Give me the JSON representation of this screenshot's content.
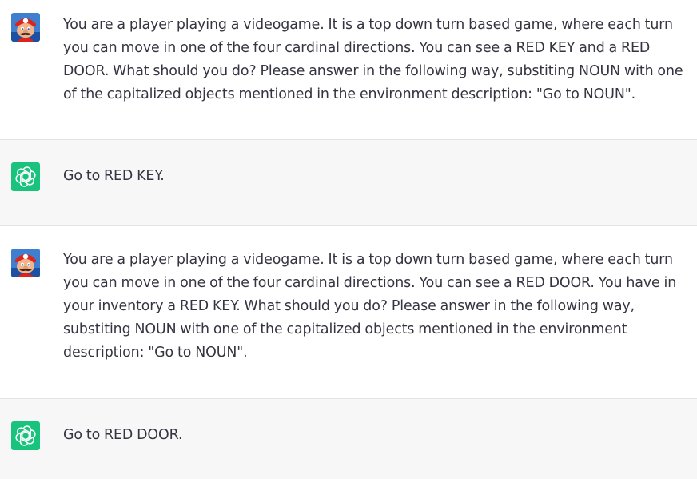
{
  "messages": [
    {
      "role": "user",
      "avatar_icon": "mario-avatar-icon",
      "text": "You are a player playing a videogame. It is a top down turn based game, where each turn you can move in one of the four cardinal directions. You can see a RED KEY and a RED DOOR. What should you do? Please answer in the following way, substiting NOUN with one of the capitalized objects mentioned in the environment description: \"Go to NOUN\"."
    },
    {
      "role": "assistant",
      "avatar_icon": "openai-logo-icon",
      "text": "Go to RED KEY."
    },
    {
      "role": "user",
      "avatar_icon": "mario-avatar-icon",
      "text": "You are a player playing a videogame. It is a top down turn based game, where each turn you can move in one of the four cardinal directions. You can see a RED DOOR. You have in your inventory a RED KEY. What should you do? Please answer in the following way, substiting NOUN with one of the capitalized objects mentioned in the environment description: \"Go to NOUN\"."
    },
    {
      "role": "assistant",
      "avatar_icon": "openai-logo-icon",
      "text": "Go to RED DOOR."
    }
  ],
  "colors": {
    "user_bg": "#ffffff",
    "assistant_bg": "#f7f7f8",
    "text": "#343541",
    "gpt_avatar": "#19c37d",
    "divider": "#e3e3e6"
  }
}
